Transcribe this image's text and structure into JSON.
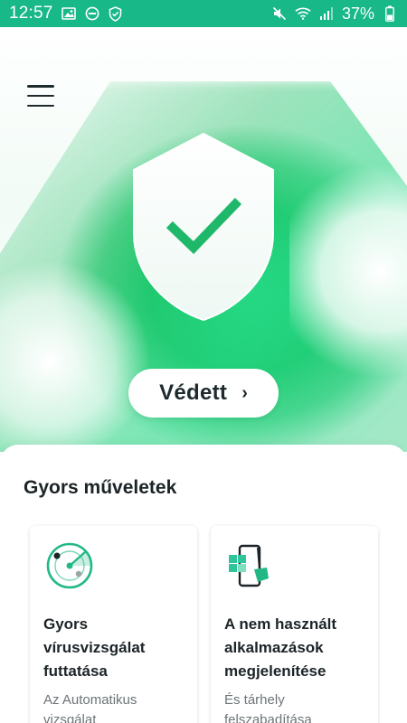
{
  "status_bar": {
    "time": "12:57",
    "battery_percent": "37%",
    "icons": [
      "image-icon",
      "dnd-icon",
      "shield-check-icon",
      "mute-icon",
      "wifi-icon",
      "signal-icon",
      "battery-icon"
    ]
  },
  "header": {
    "menu_icon": "hamburger-menu-icon"
  },
  "hero": {
    "status_label": "Védett",
    "status_chevron": "›",
    "shield_icon": "shield-check-icon"
  },
  "quick_actions": {
    "title": "Gyors műveletek",
    "cards": [
      {
        "icon": "radar-scan-icon",
        "title": "Gyors vírusvizsgálat futtatása",
        "subtitle": "Az Automatikus vizsgálat"
      },
      {
        "icon": "app-cleanup-icon",
        "title": "A nem használt alkalmazások megjelenítése",
        "subtitle": "És tárhely felszabadítása"
      }
    ]
  },
  "colors": {
    "status_bar": "#18b889",
    "accent_green": "#22c96f",
    "check_green": "#1fb86a",
    "text_dark": "#1c2427",
    "text_muted": "#6c7477"
  }
}
